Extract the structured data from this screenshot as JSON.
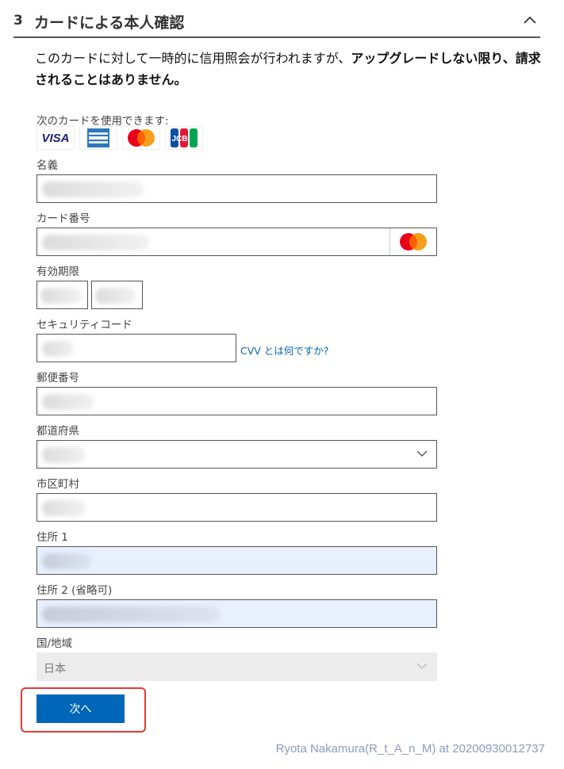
{
  "section": {
    "step": "3",
    "title": "カードによる本人確認"
  },
  "notice": {
    "normal": "このカードに対して一時的に信用照会が行われますが、",
    "bold": "アップグレードしない限り、請求されることはありません。"
  },
  "accepted_cards": {
    "label": "次のカードを使用できます:",
    "visa": "VISA",
    "amex": "AMERICAN EXPRESS",
    "jcb": "JCB"
  },
  "fields": {
    "name_label": "名義",
    "card_number_label": "カード番号",
    "expiry_label": "有効期限",
    "security_code_label": "セキュリティコード",
    "cvv_link": "CVV とは何ですか?",
    "postal_code_label": "郵便番号",
    "prefecture_label": "都道府県",
    "city_label": "市区町村",
    "address1_label": "住所 1",
    "address2_label": "住所 2 (省略可)",
    "country_label": "国/地域",
    "country_value": "日本"
  },
  "buttons": {
    "next": "次へ"
  },
  "watermark": "Ryota Nakamura(R_t_A_n_M) at 20200930012737",
  "colors": {
    "accent": "#0067b8",
    "highlight": "#e53935",
    "autofill": "#e8f0fe"
  }
}
